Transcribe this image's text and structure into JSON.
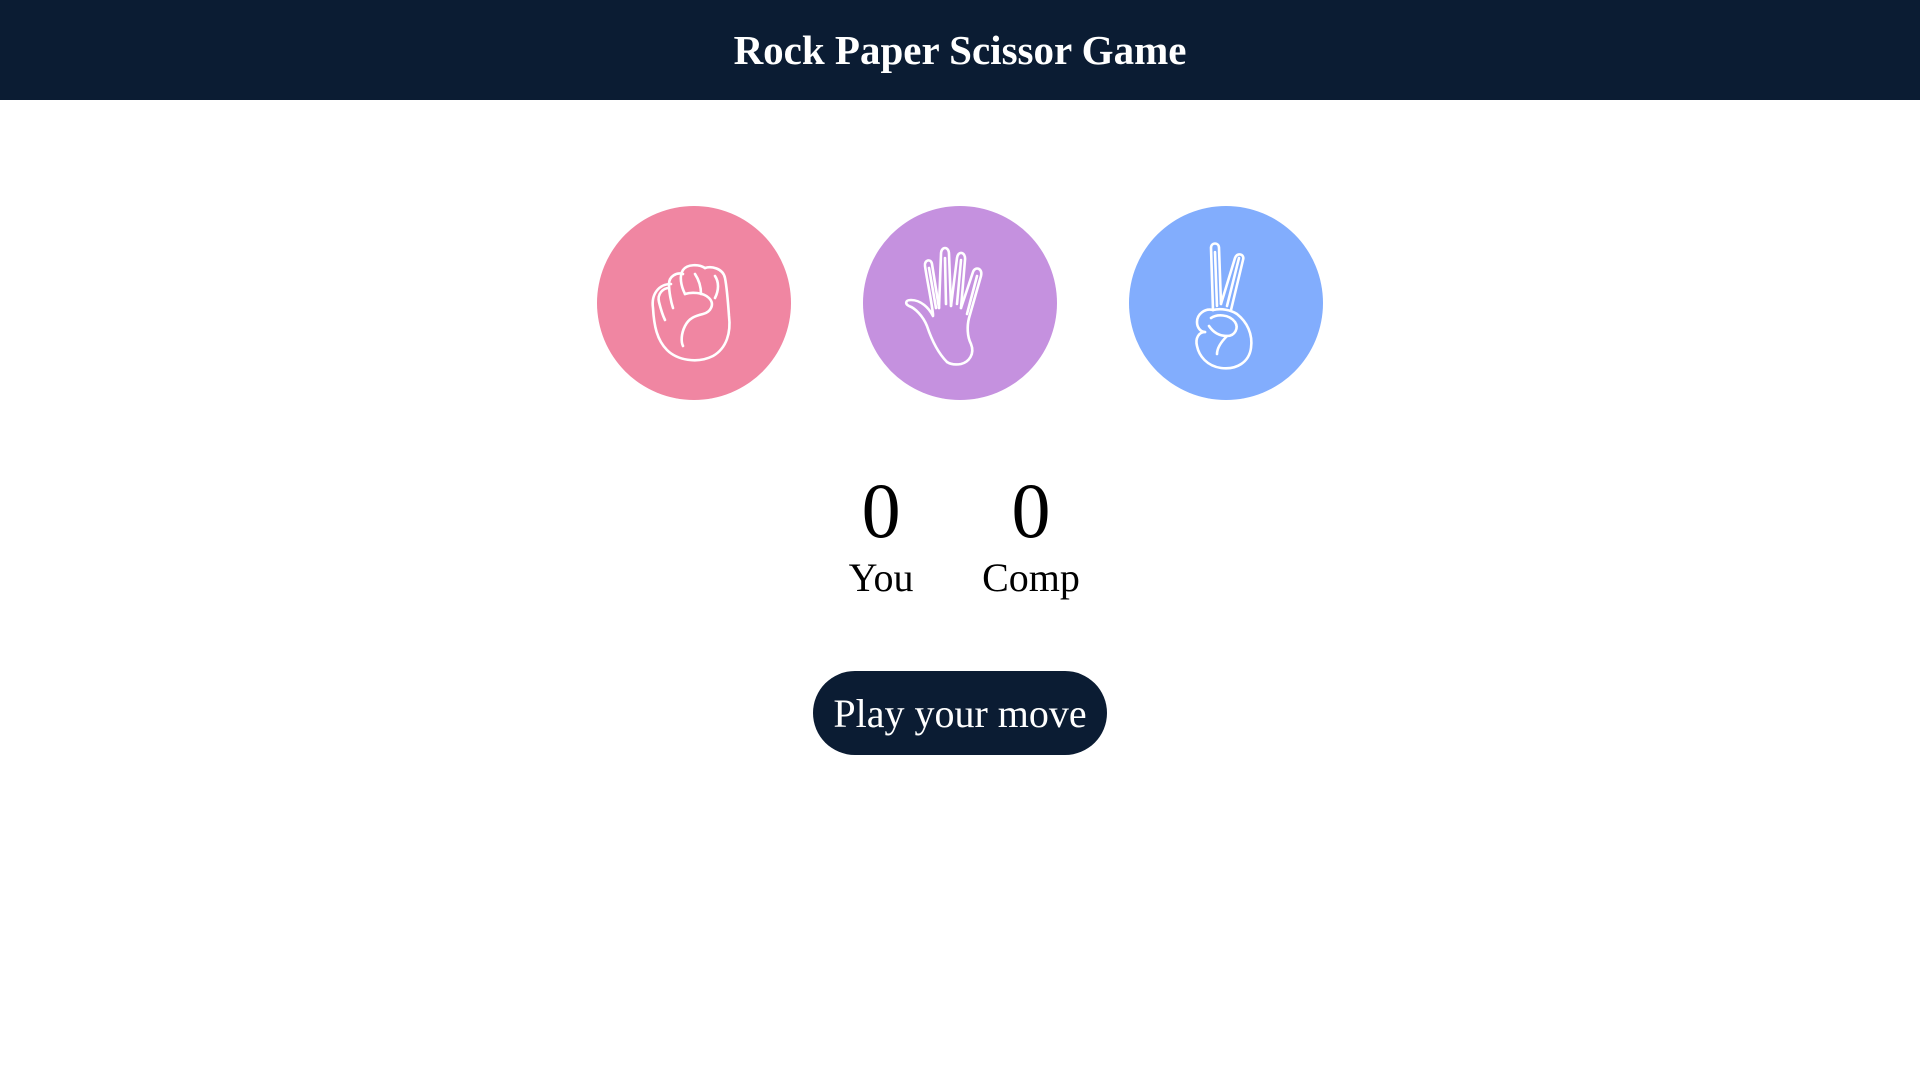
{
  "header": {
    "title": "Rock Paper Scissor Game"
  },
  "choices": [
    {
      "id": "rock",
      "icon": "fist-hand-icon",
      "color": "#f086a2"
    },
    {
      "id": "paper",
      "icon": "open-hand-icon",
      "color": "#c591df"
    },
    {
      "id": "scissors",
      "icon": "peace-hand-icon",
      "color": "#82adfd"
    }
  ],
  "scoreboard": {
    "user": {
      "score": "0",
      "label": "You"
    },
    "comp": {
      "score": "0",
      "label": "Comp"
    }
  },
  "message": {
    "text": "Play your move",
    "color": "#0b1c33"
  }
}
